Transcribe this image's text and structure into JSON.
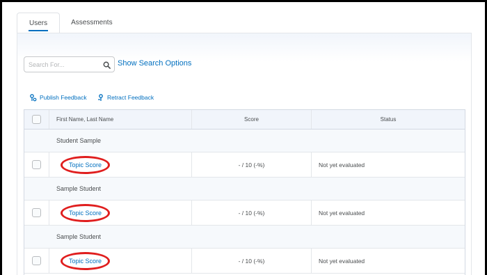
{
  "tabs": [
    {
      "label": "Users",
      "active": true
    },
    {
      "label": "Assessments",
      "active": false
    }
  ],
  "search": {
    "placeholder": "Search For...",
    "value": "",
    "icon": "search-icon"
  },
  "show_search_options": "Show Search Options",
  "actions": {
    "publish": {
      "label": "Publish Feedback",
      "icon": "publish-icon"
    },
    "retract": {
      "label": "Retract Feedback",
      "icon": "retract-icon"
    }
  },
  "table": {
    "headers": {
      "name": "First Name, Last Name",
      "score": "Score",
      "status": "Status"
    },
    "rows": [
      {
        "name": "Student Sample",
        "link": "Topic Score",
        "score": "- / 10 (-%)",
        "status": "Not yet evaluated"
      },
      {
        "name": "Sample Student",
        "link": "Topic Score",
        "score": "- / 10 (-%)",
        "status": "Not yet evaluated"
      },
      {
        "name": "Sample Student",
        "link": "Topic Score",
        "score": "- / 10 (-%)",
        "status": "Not yet evaluated"
      }
    ]
  },
  "colors": {
    "link": "#006fbf",
    "highlight": "#e01e1e",
    "border": "#000000"
  }
}
